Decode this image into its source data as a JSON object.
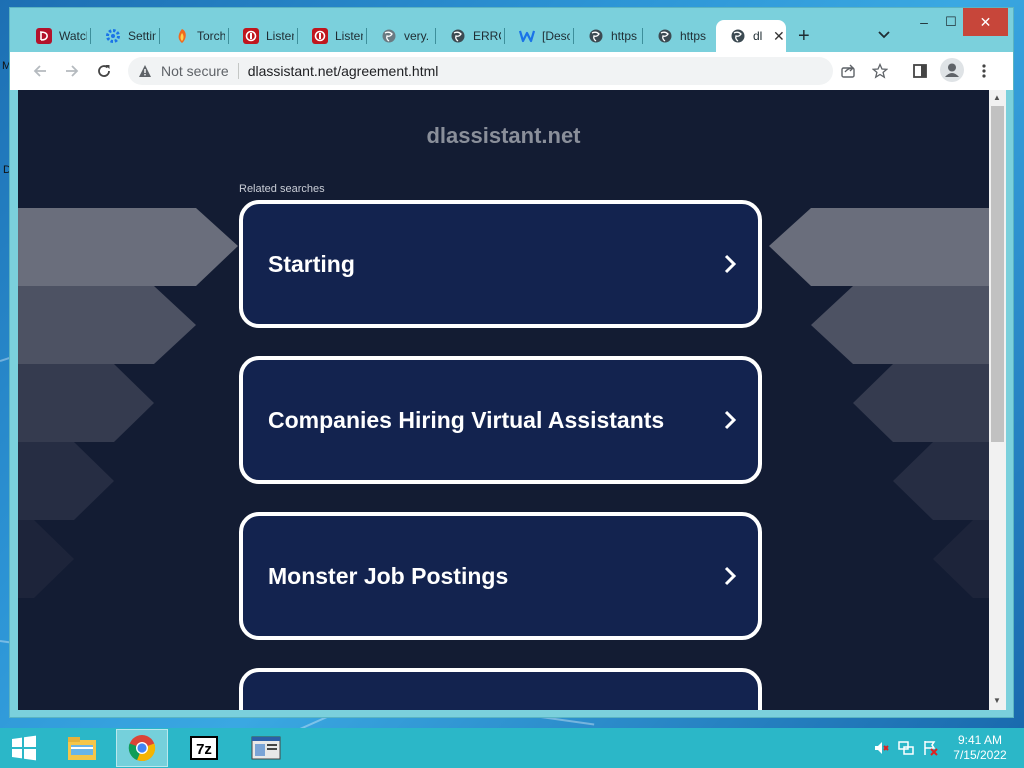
{
  "tabs": [
    {
      "label": "Watch",
      "icon": "disney-plus-icon",
      "active": false
    },
    {
      "label": "Settings",
      "icon": "settings-gear-icon",
      "active": false
    },
    {
      "label": "Torch",
      "icon": "torch-icon",
      "active": false
    },
    {
      "label": "Listen",
      "icon": "listen-icon",
      "active": false
    },
    {
      "label": "Listen",
      "icon": "listen-icon",
      "active": false
    },
    {
      "label": "very.",
      "icon": "globe-icon",
      "active": false
    },
    {
      "label": "ERROR",
      "icon": "globe-icon",
      "active": false
    },
    {
      "label": "[Desc",
      "icon": "w-icon",
      "active": false
    },
    {
      "label": "https",
      "icon": "globe-icon",
      "active": false
    },
    {
      "label": "https",
      "icon": "globe-icon",
      "active": false
    },
    {
      "label": "dl",
      "icon": "globe-icon",
      "active": true
    }
  ],
  "new_tab_symbol": "+",
  "tab_search_symbol": "⌄",
  "tab_close_symbol": "✕",
  "window_controls": {
    "minimize": "–",
    "maximize": "☐",
    "close": "✕"
  },
  "address_bar": {
    "security_label": "Not secure",
    "url": "dlassistant.net/agreement.html"
  },
  "page": {
    "site_title": "dlassistant.net",
    "related_label": "Related searches",
    "results": [
      {
        "label": "Starting"
      },
      {
        "label": "Companies Hiring Virtual Assistants"
      },
      {
        "label": "Monster Job Postings"
      },
      {
        "label": ""
      }
    ]
  },
  "taskbar": {
    "apps": [
      "start-button",
      "file-explorer-icon",
      "chrome-icon",
      "7zip-icon",
      "window-app-icon"
    ],
    "time": "9:41 AM",
    "date": "7/15/2022"
  },
  "desktop": {
    "edge_glyphs": [
      "M",
      "D"
    ]
  },
  "colors": {
    "page_bg": "#131c33",
    "card_bg": "#13234f",
    "card_border": "#ffffff",
    "tab_strip": "#7bd0dc",
    "taskbar": "#2bb7c8",
    "close_button": "#c7463a"
  }
}
